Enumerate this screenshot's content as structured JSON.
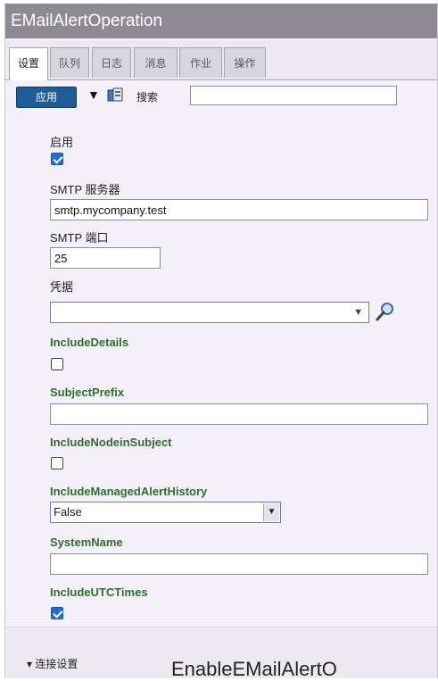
{
  "window": {
    "title": "EMailAlertOperation"
  },
  "tabs": [
    {
      "label": "设置",
      "active": true
    },
    {
      "label": "队列",
      "active": false
    },
    {
      "label": "日志",
      "active": false
    },
    {
      "label": "消息",
      "active": false
    },
    {
      "label": "作业",
      "active": false
    },
    {
      "label": "操作",
      "active": false
    }
  ],
  "toolbar": {
    "apply_label": "应用",
    "dropdown_arrow": "▼",
    "search_label": "搜索",
    "search_value": ""
  },
  "fields": {
    "enable": {
      "label": "启用",
      "checked": true
    },
    "smtp_server": {
      "label": "SMTP 服务器",
      "value": "smtp.mycompany.test"
    },
    "smtp_port": {
      "label": "SMTP 端口",
      "value": "25"
    },
    "credentials": {
      "label": "凭据",
      "value": ""
    },
    "include_details": {
      "label": "IncludeDetails",
      "checked": false
    },
    "subject_prefix": {
      "label": "SubjectPrefix",
      "value": ""
    },
    "include_node_in_subject": {
      "label": "IncludeNodeinSubject",
      "checked": false
    },
    "include_managed_alert_history": {
      "label": "IncludeManagedAlertHistory",
      "value": "False"
    },
    "system_name": {
      "label": "SystemName",
      "value": ""
    },
    "include_utc_times": {
      "label": "IncludeUTCTimes",
      "checked": true
    }
  },
  "footer": {
    "section_label": "▾ 连接设置"
  },
  "caption": {
    "text": "EnableEMailAlertO"
  },
  "colors": {
    "accent": "#1f5d97",
    "title_bar": "#8d8a93",
    "setting_label": "#2e6e2e"
  }
}
